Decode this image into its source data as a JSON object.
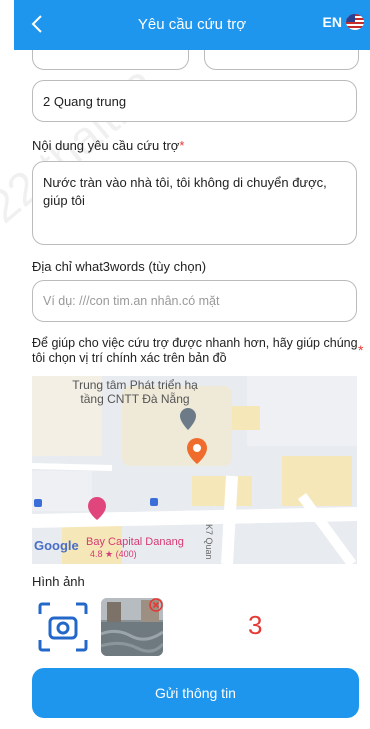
{
  "header": {
    "title": "Yêu cầu cứu trợ",
    "lang_code": "EN",
    "accent": "#1e96ee"
  },
  "address": {
    "value": "2 Quang trung"
  },
  "request": {
    "label": "Nội dung yêu cầu cứu trợ",
    "required_mark": "*",
    "value": "Nước tràn vào nhà tôi, tôi không di chuyển được, giúp tôi"
  },
  "what3words": {
    "label": "Địa chỉ what3words (tùy chọn)",
    "placeholder": "Ví dụ: ///con tim.an nhân.có mặt"
  },
  "location": {
    "instruction": "Để giúp cho việc cứu trợ được nhanh hơn, hãy giúp chúng tôi chọn vị trí chính xác trên bản đồ",
    "required_mark": "*"
  },
  "map": {
    "poi_name": "Trung tâm Phát triển hạ tầng CNTT Đà Nẵng",
    "poi2_name": "Bay Capital Danang",
    "poi2_rating": "4.8 ★ (400)",
    "street": "K7 Quan",
    "google_label": "Google"
  },
  "images": {
    "label": "Hình ảnh",
    "count": "3"
  },
  "submit_label": "Gửi thông tin",
  "watermark": "22-thaith2"
}
